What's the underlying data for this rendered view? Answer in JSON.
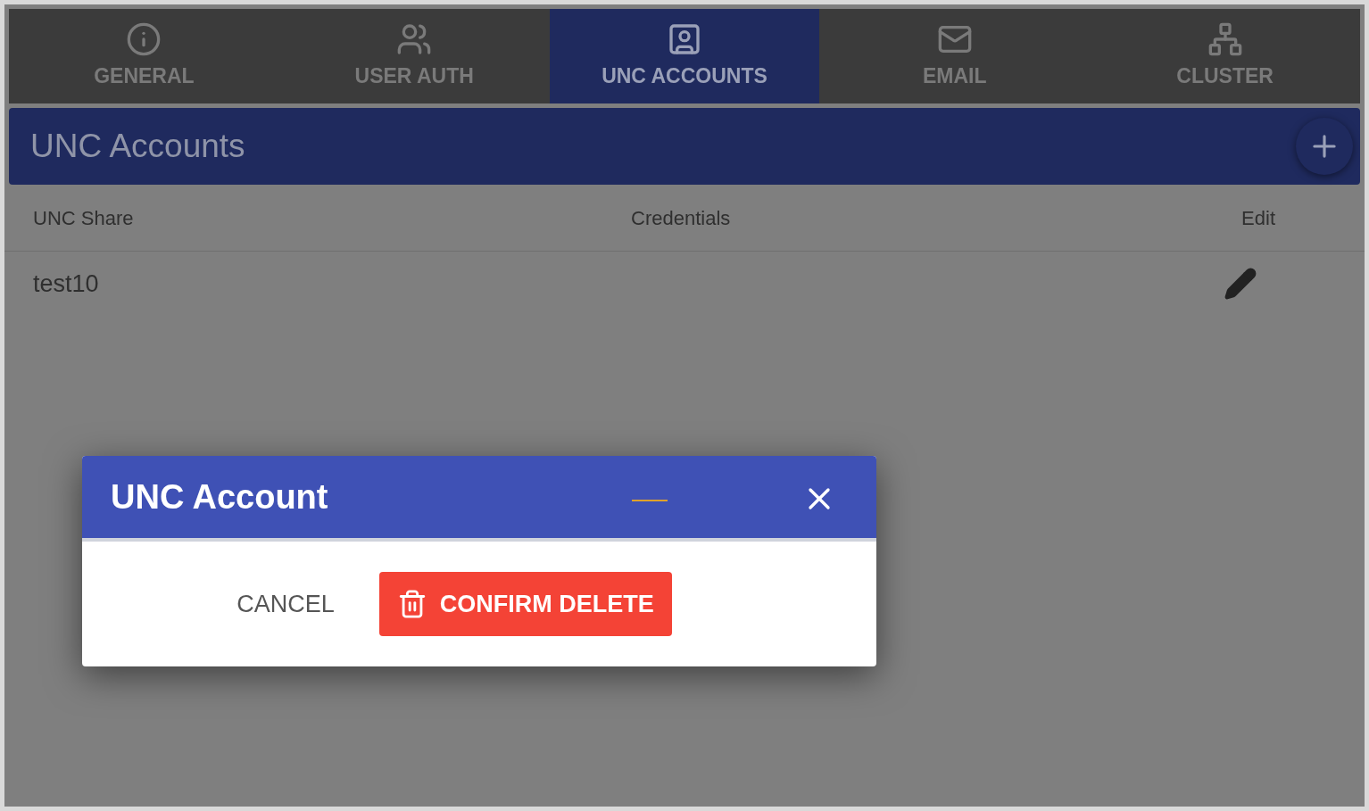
{
  "tabs": [
    {
      "label": "GENERAL",
      "selected": false
    },
    {
      "label": "USER AUTH",
      "selected": false
    },
    {
      "label": "UNC ACCOUNTS",
      "selected": true
    },
    {
      "label": "EMAIL",
      "selected": false
    },
    {
      "label": "CLUSTER",
      "selected": false
    }
  ],
  "panel": {
    "title": "UNC Accounts"
  },
  "table": {
    "columns": [
      "UNC Share",
      "Credentials",
      "Edit"
    ],
    "rows": [
      {
        "unc_share": "test10",
        "credentials": ""
      }
    ]
  },
  "dialog": {
    "title": "UNC Account",
    "buttons": [
      {
        "label": "CANCEL",
        "kind": "text"
      },
      {
        "label": "CONFIRM DELETE",
        "kind": "danger"
      }
    ]
  }
}
